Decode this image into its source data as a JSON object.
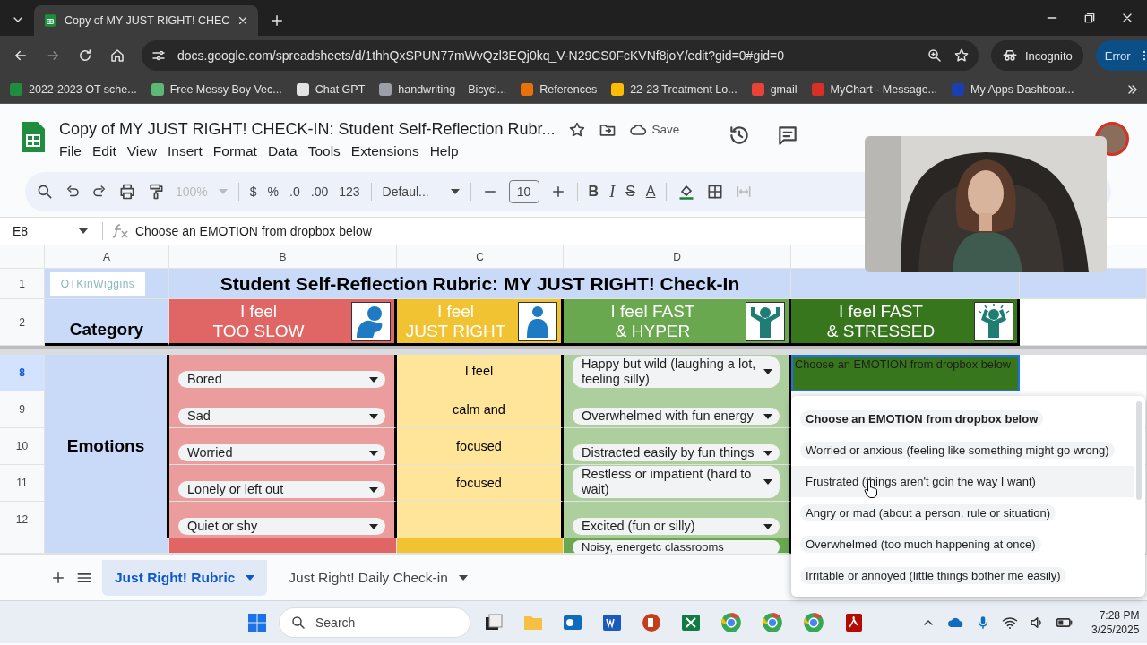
{
  "browser": {
    "tabs": [
      {
        "title": "Copy of MY JUST RIGHT! CHEC",
        "selected": true
      }
    ],
    "url": "docs.google.com/spreadsheets/d/1thhQxSPUN77mWvQzl3EQj0kq_V-N29CS0FcKVNf8joY/edit?gid=0#gid=0",
    "profile": "Incognito",
    "status": "Error",
    "bookmarks": [
      {
        "label": "2022-2023 OT sche...",
        "color": "#1e8e3e"
      },
      {
        "label": "Free Messy Boy Vec...",
        "color": "#5bb974"
      },
      {
        "label": "Chat GPT",
        "color": "#e3e3e3"
      },
      {
        "label": "handwriting – Bicycl...",
        "color": "#9aa0a6"
      },
      {
        "label": "References",
        "color": "#e8710a"
      },
      {
        "label": "22-23 Treatment Lo...",
        "color": "#fbbc04"
      },
      {
        "label": "gmail",
        "color": "#ea4335"
      },
      {
        "label": "MyChart - Message...",
        "color": "#d93025"
      },
      {
        "label": "My Apps Dashboar...",
        "color": "#1a3fb0"
      }
    ]
  },
  "doc": {
    "title": "Copy of MY JUST RIGHT! CHECK-IN: Student Self-Reflection Rubr...",
    "save": "Save",
    "menu": [
      "File",
      "Edit",
      "View",
      "Insert",
      "Format",
      "Data",
      "Tools",
      "Extensions",
      "Help"
    ]
  },
  "toolbar": {
    "zoom": "100%",
    "currency": "$",
    "percent": "%",
    "decrease_decimals": ".0",
    "increase_decimals": ".00",
    "number_format": "123",
    "font": "Defaul...",
    "font_size": "10",
    "bold": "B",
    "italic": "I",
    "strikethrough": "S",
    "text_color": "A"
  },
  "formula_bar": {
    "cell": "E8",
    "formula": "Choose an EMOTION from dropbox below"
  },
  "grid": {
    "columns": [
      {
        "label": "A",
        "selected": false
      },
      {
        "label": "B",
        "selected": false
      },
      {
        "label": "C",
        "selected": false
      },
      {
        "label": "D",
        "selected": false
      }
    ],
    "logo_text": "OTKinWiggins",
    "header_rows": [
      "1",
      "2"
    ],
    "title": "Student Self-Reflection Rubric: MY JUST RIGHT! Check-In",
    "category_header": "Category",
    "levels": [
      {
        "line1": "I feel",
        "line2": "TOO SLOW",
        "color": "#e06666",
        "kind": "slumped"
      },
      {
        "line1": "I feel",
        "line2": "JUST RIGHT",
        "color": "#f1c232",
        "kind": "standing"
      },
      {
        "line1": "I feel FAST",
        "line2": "& HYPER",
        "color": "#6aa84f",
        "kind": "arms-up"
      },
      {
        "line1": "I feel FAST",
        "line2": "& STRESSED",
        "color": "#38761d",
        "kind": "hands-on-head"
      }
    ],
    "section": "Emotions",
    "rows": [
      {
        "number": "8",
        "selected": true,
        "slow": "Bored",
        "right": "I feel",
        "hyper": "Happy but wild (laughing a lot, feeling silly)"
      },
      {
        "number": "9",
        "selected": false,
        "slow": "Sad",
        "right": "calm and",
        "hyper": "Overwhelmed with fun energy"
      },
      {
        "number": "10",
        "selected": false,
        "slow": "Worried",
        "right": "focused",
        "hyper": "Distracted easily by fun things"
      },
      {
        "number": "11",
        "selected": false,
        "slow": "Lonely or left out",
        "right": "focused",
        "hyper": "Restless or impatient (hard to wait)"
      },
      {
        "number": "12",
        "selected": false,
        "slow": "Quiet or shy",
        "right": "",
        "hyper": "Excited (fun or silly)"
      }
    ],
    "next_row_hyper": "Noisy, energetc classrooms",
    "active_cell": "Choose an EMOTION from dropbox below"
  },
  "dropdown": [
    {
      "label": "Choose an EMOTION from dropbox below",
      "selected": true,
      "hovered": false
    },
    {
      "label": "Worried or anxious (feeling like something might go wrong)",
      "selected": false,
      "hovered": false
    },
    {
      "label": "Frustrated (things aren't goin the way I want)",
      "selected": false,
      "hovered": true
    },
    {
      "label": "Angry or mad (about a person, rule or situation)",
      "selected": false,
      "hovered": false
    },
    {
      "label": "Overwhelmed (too much happening at once)",
      "selected": false,
      "hovered": false
    },
    {
      "label": "Irritable or annoyed (little things bother me easily)",
      "selected": false,
      "hovered": false
    }
  ],
  "sheet_tabs": [
    {
      "label": "Just Right! Rubric",
      "selected": true
    },
    {
      "label": "Just Right! Daily Check-in",
      "selected": false
    }
  ],
  "taskbar": {
    "search": "Search",
    "time": "7:28 PM",
    "date": "3/25/2025"
  }
}
